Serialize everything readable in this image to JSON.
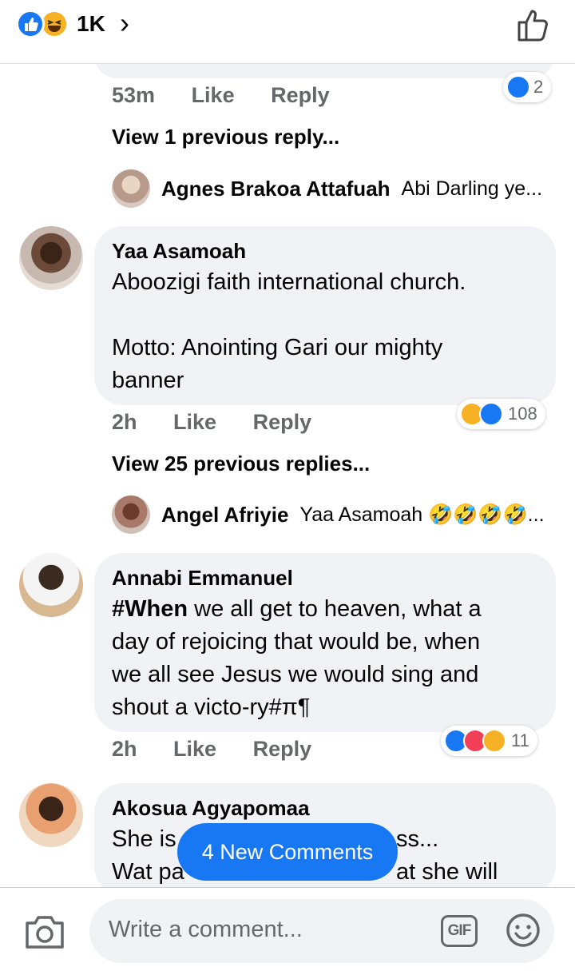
{
  "header": {
    "reaction_count": "1K",
    "chevron": "›",
    "reaction_icons": [
      "like-icon",
      "haha-icon"
    ],
    "action_icon": "thumbs-up-outline-icon"
  },
  "comments": [
    {
      "id": "c0",
      "time": "53m",
      "like_label": "Like",
      "reply_label": "Reply",
      "reactions": {
        "icons": [
          "like"
        ],
        "count": "2"
      },
      "view_previous": "View 1 previous reply...",
      "latest_reply": {
        "name": "Agnes Brakoa Attafuah",
        "text": "Abi Darling ye..."
      }
    },
    {
      "id": "c1",
      "name": "Yaa Asamoah",
      "lines": [
        "Aboozigi faith international church.",
        "",
        "Motto: Anointing Gari our mighty",
        "banner"
      ],
      "time": "2h",
      "like_label": "Like",
      "reply_label": "Reply",
      "reactions": {
        "icons": [
          "haha",
          "like"
        ],
        "count": "108"
      },
      "view_previous": "View 25 previous replies...",
      "latest_reply": {
        "name": "Angel Afriyie",
        "text": "Yaa Asamoah 🤣🤣🤣🤣..."
      }
    },
    {
      "id": "c2",
      "name": "Annabi Emmanuel",
      "lines_bold_prefix": "#When",
      "lines": [
        " we all get to heaven, what a",
        "day of rejoicing that would be, when",
        "we all see Jesus we would sing and",
        "shout a victo-ry#π¶"
      ],
      "time": "2h",
      "like_label": "Like",
      "reply_label": "Reply",
      "reactions": {
        "icons": [
          "like",
          "love",
          "haha"
        ],
        "count": "11"
      }
    },
    {
      "id": "c3",
      "name": "Akosua Agyapomaa",
      "lines": [
        "She is",
        "ss...",
        "Wat pa",
        "at she will"
      ]
    }
  ],
  "new_comments_label": "4 New Comments",
  "composer": {
    "placeholder": "Write a comment...",
    "gif_label": "GIF"
  },
  "colors": {
    "accent": "#1877f2",
    "bubble": "#f0f2f5",
    "meta": "#65676b",
    "haha": "#f7b125",
    "love": "#f33e58"
  }
}
